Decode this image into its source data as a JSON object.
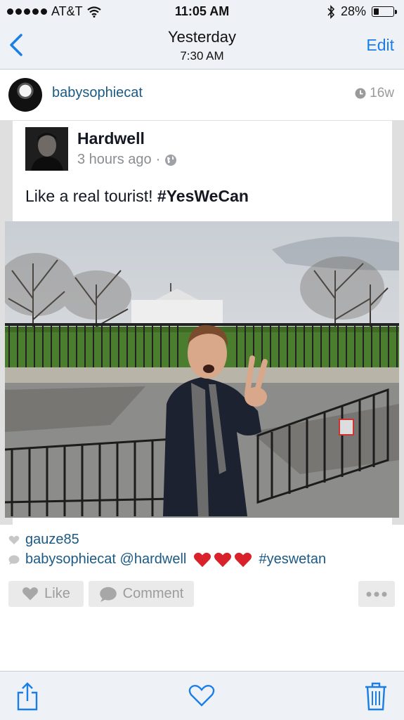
{
  "status_bar": {
    "carrier": "AT&T",
    "time": "11:05 AM",
    "battery": "28%",
    "battery_level": 0.28
  },
  "nav": {
    "title": "Yesterday",
    "subtitle": "7:30 AM",
    "edit_label": "Edit"
  },
  "post": {
    "username": "babysophiecat",
    "age": "16w"
  },
  "shared_post": {
    "author": "Hardwell",
    "time_ago": "3 hours ago",
    "separator": "·",
    "text_plain": "Like a real tourist! ",
    "text_hashtag": "#YesWeCan"
  },
  "likes": {
    "user": "gauze85"
  },
  "comment": {
    "user": "babysophiecat",
    "mention": "@hardwell",
    "hashtag": "#yeswetan"
  },
  "actions": {
    "like_label": "Like",
    "comment_label": "Comment"
  },
  "colors": {
    "link": "#1b5a84",
    "ios_blue": "#1a7ee8"
  },
  "icons": {
    "signal": "signal-dots-icon",
    "wifi": "wifi-icon",
    "bluetooth": "bluetooth-icon",
    "battery": "battery-icon",
    "back": "chevron-left-icon",
    "clock": "clock-icon",
    "globe": "globe-icon",
    "heart": "heart-icon",
    "speech": "speech-bubble-icon",
    "share": "share-icon",
    "trash": "trash-icon",
    "more": "ellipsis-icon"
  }
}
